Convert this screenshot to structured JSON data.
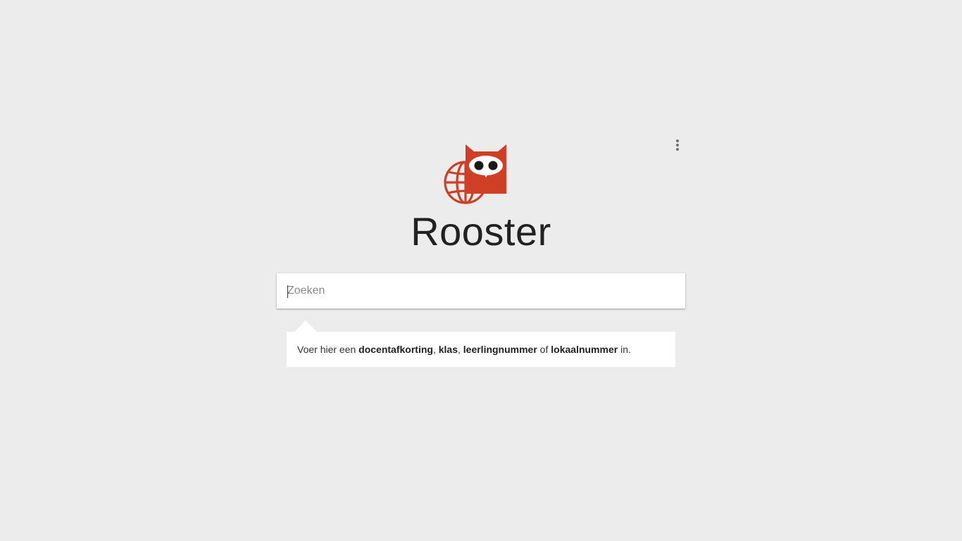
{
  "app": {
    "title": "Rooster",
    "logo_icon": "owl-globe-logo-icon",
    "brand_color": "#cf3f26"
  },
  "menu": {
    "icon": "more-vert-icon"
  },
  "search": {
    "placeholder": "Zoeken",
    "value": ""
  },
  "hint": {
    "part1": "Voer hier een ",
    "term1": "docentafkorting",
    "sep1": ", ",
    "term2": "klas",
    "sep2": ", ",
    "term3": "leerlingnummer",
    "part2": " of ",
    "term4": "lokaalnummer",
    "part3": " in."
  }
}
